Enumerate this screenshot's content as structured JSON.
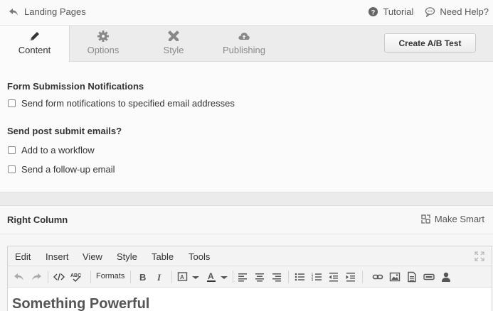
{
  "topbar": {
    "back_label": "Landing Pages",
    "tutorial_label": "Tutorial",
    "help_label": "Need Help?"
  },
  "tabs": [
    {
      "label": "Content",
      "icon": "pencil-icon",
      "active": true
    },
    {
      "label": "Options",
      "icon": "gear-icon",
      "active": false
    },
    {
      "label": "Style",
      "icon": "tools-icon",
      "active": false
    },
    {
      "label": "Publishing",
      "icon": "cloud-upload-icon",
      "active": false
    }
  ],
  "ab_test_label": "Create A/B Test",
  "form": {
    "notifications_title": "Form Submission Notifications",
    "notifications_option": "Send form notifications to specified email addresses",
    "post_submit_title": "Send post submit emails?",
    "workflow_option": "Add to a workflow",
    "followup_option": "Send a follow-up email"
  },
  "right_column": {
    "title": "Right Column",
    "make_smart_label": "Make Smart"
  },
  "editor": {
    "menu": [
      "Edit",
      "Insert",
      "View",
      "Style",
      "Table",
      "Tools"
    ],
    "formats_label": "Formats",
    "content_heading": "Something Powerful"
  },
  "colors": {
    "accent_text": "#333333",
    "muted_text": "#888888",
    "icon_gray": "#777777"
  }
}
